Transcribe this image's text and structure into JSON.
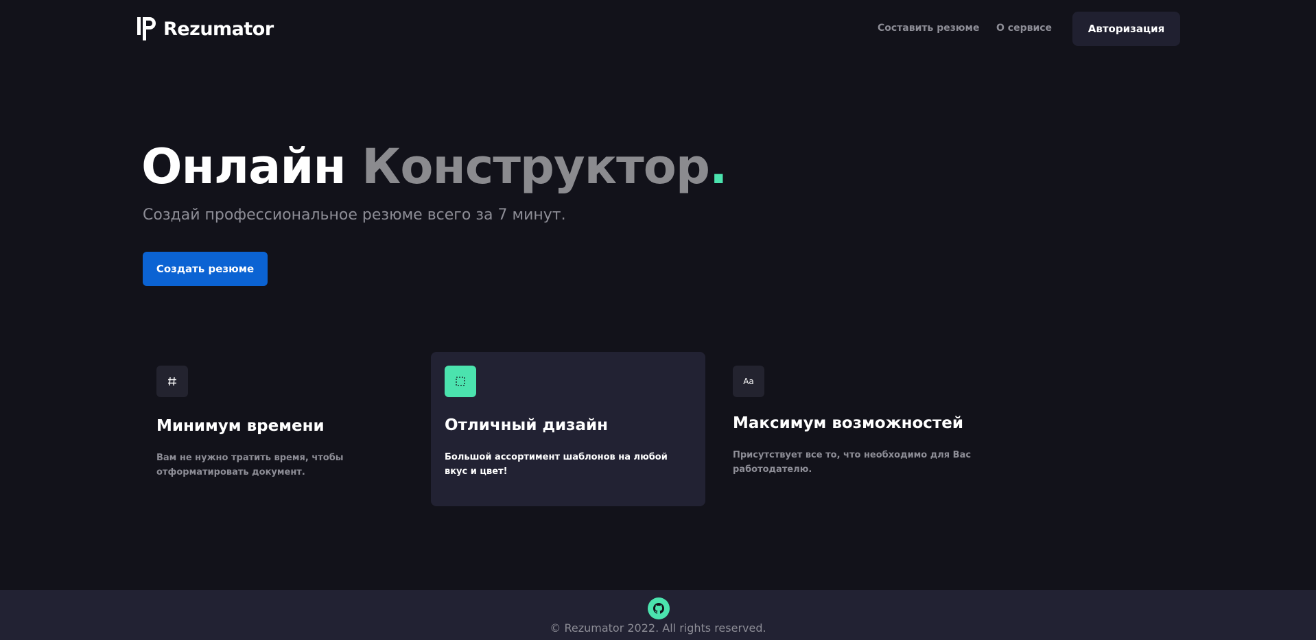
{
  "header": {
    "logo_text": "Rezumator",
    "nav": {
      "build_resume": "Составить резюме",
      "about": "О сервисе"
    },
    "auth_button": "Авторизация"
  },
  "hero": {
    "title_word1": "Онлайн",
    "title_word2": "Конструктор",
    "title_dot": ".",
    "subtitle": "Создай профессиональное резюме всего за 7 минут.",
    "cta_button": "Создать резюме"
  },
  "features": [
    {
      "icon": "hash-icon",
      "icon_glyph": "⌗",
      "title": "Минимум времени",
      "text": "Вам не нужно тратить время, чтобы отформатировать документ."
    },
    {
      "icon": "selection-icon",
      "title": "Отличный дизайн",
      "text": "Большой ассортимент шаблонов на любой вкус и цвет!"
    },
    {
      "icon": "text-format-icon",
      "icon_glyph": "Aa",
      "title": "Максимум возможностей",
      "text": "Присутствует все то, что необходимо для Вас работодателю."
    }
  ],
  "footer": {
    "github_icon": "github-icon",
    "copyright": "© Rezumator 2022. All rights reserved."
  },
  "colors": {
    "background": "#12121a",
    "surface": "#222233",
    "accent_green": "#4be3ae",
    "primary_blue": "#0b63d3",
    "muted_text": "#8d8d96"
  }
}
